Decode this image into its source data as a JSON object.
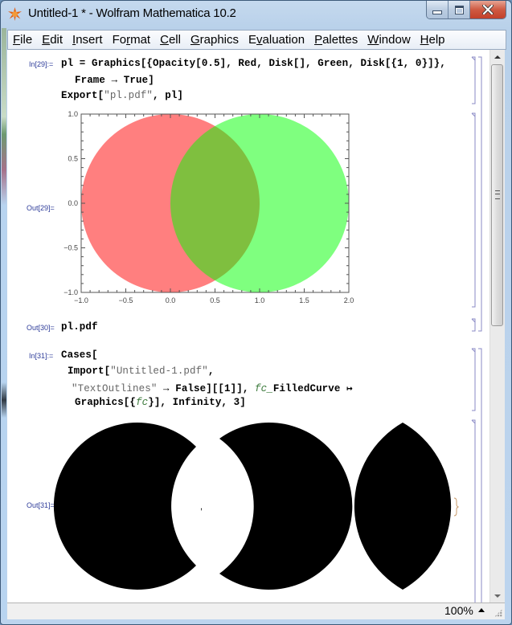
{
  "window": {
    "title": "Untitled-1 * - Wolfram Mathematica 10.2",
    "app_icon": "mathematica-spikey-icon",
    "controls": [
      "minimize",
      "maximize",
      "close"
    ]
  },
  "menu": [
    {
      "label": "File",
      "accel": "F"
    },
    {
      "label": "Edit",
      "accel": "E"
    },
    {
      "label": "Insert",
      "accel": "I"
    },
    {
      "label": "Format",
      "accel": "r"
    },
    {
      "label": "Cell",
      "accel": "C"
    },
    {
      "label": "Graphics",
      "accel": "G"
    },
    {
      "label": "Evaluation",
      "accel": "v"
    },
    {
      "label": "Palettes",
      "accel": "P"
    },
    {
      "label": "Window",
      "accel": "W"
    },
    {
      "label": "Help",
      "accel": "H"
    }
  ],
  "cells": {
    "in29": {
      "label": "In[29]:=",
      "line1_a": "pl = Graphics[{Opacity[0.5], Red, Disk[], Green, Disk[{1, 0}]},",
      "line2": "Frame → True]",
      "line3_a": "Export[",
      "line3_str": "\"pl.pdf\"",
      "line3_b": ", pl]"
    },
    "out29": {
      "label": "Out[29]="
    },
    "out30": {
      "label": "Out[30]=",
      "value": "pl.pdf"
    },
    "in31": {
      "label": "In[31]:=",
      "line1": "Cases[",
      "line2_a": "Import[",
      "line2_str": "\"Untitled-1.pdf\"",
      "line2_b": ",",
      "line3_str": "\"TextOutlines\"",
      "line3_b": " → False][[1]], ",
      "line3_pat": "fc_",
      "line3_c": "FilledCurve ↦",
      "line4_a": "Graphics[{",
      "line4_pat": "fc",
      "line4_b": "}], Infinity, 3]"
    },
    "out31": {
      "label": "Out[31]=",
      "list_open": "{",
      "list_close": "}",
      "separator": ",",
      "items": [
        "left-crescent",
        "right-crescent",
        "lens"
      ]
    }
  },
  "chart_data": {
    "type": "scatter",
    "title": "",
    "xlabel": "",
    "ylabel": "",
    "xlim": [
      -1.0,
      2.0
    ],
    "ylim": [
      -1.0,
      1.0
    ],
    "x_ticks": [
      "−1.0",
      "−0.5",
      "0.0",
      "0.5",
      "1.0",
      "1.5",
      "2.0"
    ],
    "x_tick_values": [
      -1.0,
      -0.5,
      0.0,
      0.5,
      1.0,
      1.5,
      2.0
    ],
    "y_ticks": [
      "−1.0",
      "−0.5",
      "0.0",
      "0.5",
      "1.0"
    ],
    "y_tick_values": [
      -1.0,
      -0.5,
      0.0,
      0.5,
      1.0
    ],
    "frame": true,
    "grid": false,
    "series": [
      {
        "name": "Red Disk",
        "shape": "disk",
        "center": [
          0,
          0
        ],
        "radius": 1,
        "color": "#ff0000",
        "opacity": 0.5
      },
      {
        "name": "Green Disk",
        "shape": "disk",
        "center": [
          1,
          0
        ],
        "radius": 1,
        "color": "#00ff00",
        "opacity": 0.5
      }
    ]
  },
  "status": {
    "zoom": "100%"
  },
  "colors": {
    "cell_label": "#2f3d9a",
    "bracket": "#8a8ac6",
    "string": "#666666",
    "pattern": "#3c7a3c"
  }
}
